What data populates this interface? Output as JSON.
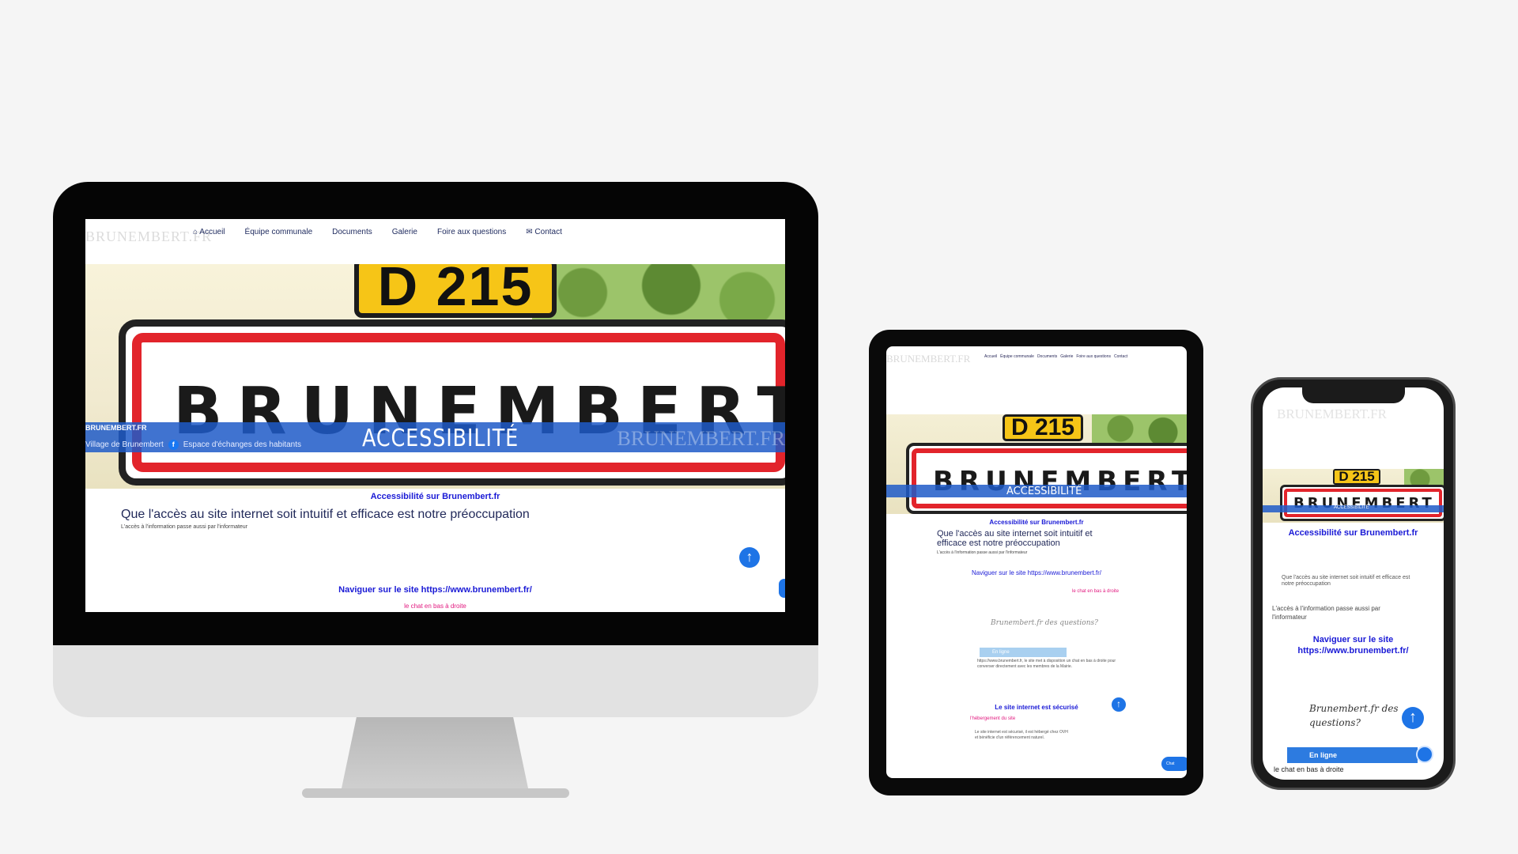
{
  "desktop": {
    "logo": "BRUNEMBERT.FR",
    "menu": [
      {
        "icon": "home-icon",
        "label": "Accueil"
      },
      {
        "icon": "",
        "label": "Équipe communale"
      },
      {
        "icon": "",
        "label": "Documents"
      },
      {
        "icon": "",
        "label": "Galerie"
      },
      {
        "icon": "",
        "label": "Foire aux questions"
      },
      {
        "icon": "mail-icon",
        "label": "Contact"
      }
    ],
    "hero": {
      "road_sign": "D 215",
      "town_sign": "BRUNEMBERT",
      "banner_site": "BRUNEMBERT.FR",
      "banner_title": "ACCESSIBILITÉ",
      "banner_watermark": "BRUNEMBERT.FR",
      "banner_link_1": "Village de Brunembert",
      "banner_link_2": "Espace d'échanges des habitants"
    },
    "accessibility_heading": "Accessibilité sur Brunembert.fr",
    "headline": "Que l'accès au site internet soit intuitif et efficace est notre préoccupation",
    "subline": "L'accès à l'information passe aussi par l'informateur",
    "navigate_heading": "Naviguer sur le site https://www.brunembert.fr/",
    "chat_note": "le chat en bas à droite"
  },
  "tablet": {
    "logo": "BRUNEMBERT.FR",
    "menu": [
      "Accueil",
      "Équipe communale",
      "Documents",
      "Galerie",
      "Foire aux questions",
      "Contact"
    ],
    "road_sign": "D 215",
    "town_sign": "BRUNEMBERT",
    "banner_title": "ACCESSIBILITÉ",
    "accessibility_heading": "Accessibilité sur Brunembert.fr",
    "headline": "Que l'accès au site internet soit intuitif et efficace est notre préoccupation",
    "subline": "L'accès à l'information passe aussi par l'informateur",
    "navigate_heading": "Naviguer sur le site https://www.brunembert.fr/",
    "chat_note": "le chat en bas à droite",
    "widget_text": "Brunembert.fr des questions?",
    "online_label": "En ligne",
    "small_text": "https://www.brunembert.fr, le site met à disposition un chat en bas à droite pour converser directement avec les membres de la Mairie.",
    "secure_heading": "Le site internet est sécurisé",
    "hosting_label": "l'hébergement du site",
    "secure_text": "Le site internet est sécurisé, il est hébergé chez OVH et bénéficie d'un référencement naturel.",
    "chat_button": "Chat"
  },
  "phone": {
    "logo": "BRUNEMBERT.FR",
    "road_sign": "D 215",
    "town_sign": "BRUNEMBERT",
    "banner_title": "ACCESSIBILITÉ",
    "accessibility_heading": "Accessibilité sur Brunembert.fr",
    "headline": "Que l'accès au site internet soit intuitif et efficace est notre préoccupation",
    "subline": "L'accès à l'information passe aussi par l'informateur",
    "navigate_heading": "Naviguer sur le site https://www.brunembert.fr/",
    "widget_text": "Brunembert.fr des questions?",
    "online_label": "En ligne",
    "chat_note": "le chat en bas à droite"
  },
  "colors": {
    "accent_blue": "#1e74e6",
    "link_blue": "#1a1ad6",
    "pink": "#e2197f",
    "sign_red": "#e2242b",
    "sign_yellow": "#f6c517"
  }
}
